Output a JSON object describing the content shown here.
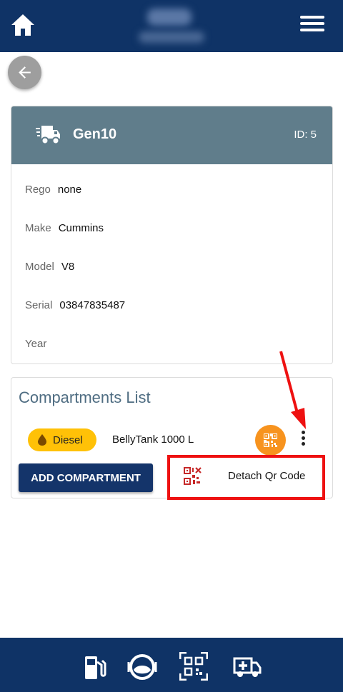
{
  "header": {
    "home_icon": "home-icon",
    "menu_icon": "hamburger-menu-icon",
    "title_blurred": true
  },
  "back_button": {
    "icon": "arrow-left-icon"
  },
  "equipment": {
    "name": "Gen10",
    "id_label": "ID: 5",
    "icon": "truck-fast-icon",
    "header_color": "#607d8b",
    "fields": [
      {
        "label": "Rego",
        "value": "none"
      },
      {
        "label": "Make",
        "value": "Cummins"
      },
      {
        "label": "Model",
        "value": "V8"
      },
      {
        "label": "Serial",
        "value": "03847835487"
      },
      {
        "label": "Year",
        "value": ""
      }
    ]
  },
  "compartments": {
    "title": "Compartments List",
    "items": [
      {
        "fuel_type": "Diesel",
        "fuel_color": "#ffc107",
        "name": "BellyTank 1000 L",
        "qr_button_color": "#f7931e"
      }
    ],
    "add_button_label": "ADD COMPARTMENT"
  },
  "context_menu": {
    "items": [
      {
        "icon": "qrcode-remove-icon",
        "label": "Detach Qr Code"
      }
    ]
  },
  "annotation": {
    "color": "#ee1111"
  },
  "bottom_nav": {
    "items": [
      {
        "icon": "fuel-pump-icon"
      },
      {
        "icon": "tank-gauge-icon"
      },
      {
        "icon": "qr-scan-icon"
      },
      {
        "icon": "ambulance-icon"
      }
    ]
  },
  "colors": {
    "primary": "#0f3366",
    "button": "#14346a",
    "accent": "#f7931e"
  }
}
